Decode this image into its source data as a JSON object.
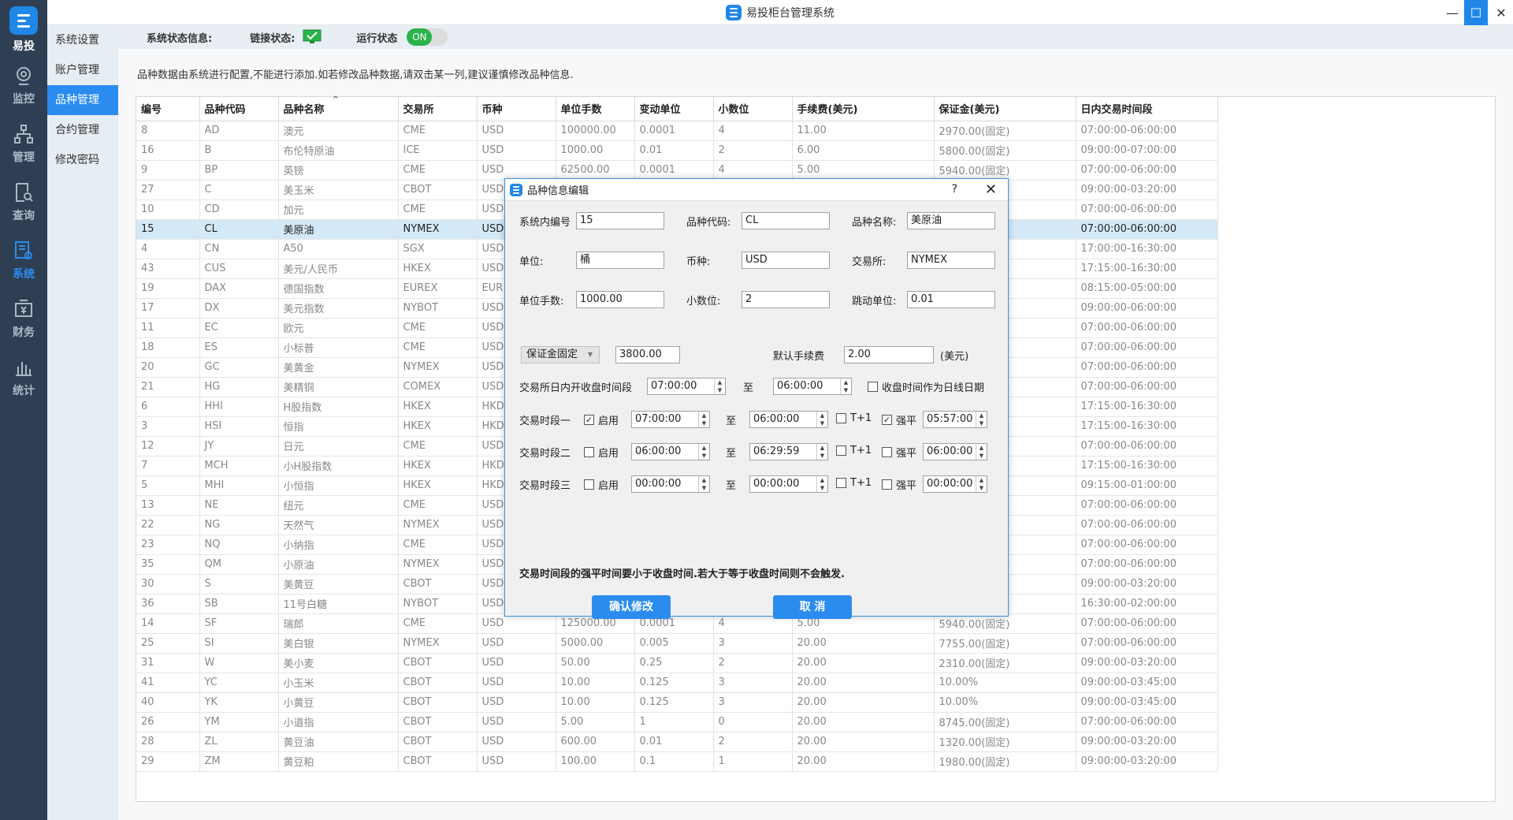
{
  "app": {
    "title": "易投柜台管理系统",
    "logo_label": "易投",
    "accent_color": "#1f87e8",
    "sidebar_bg": "#2f3f53"
  },
  "nav": [
    {
      "label": "监控",
      "icon": "monitor-camera-icon"
    },
    {
      "label": "管理",
      "icon": "org-chart-icon"
    },
    {
      "label": "查询",
      "icon": "search-document-icon"
    },
    {
      "label": "系统",
      "icon": "system-settings-icon",
      "active": true
    },
    {
      "label": "财务",
      "icon": "finance-icon"
    },
    {
      "label": "统计",
      "icon": "bar-chart-icon"
    }
  ],
  "subnav": [
    {
      "label": "系统设置"
    },
    {
      "label": "账户管理"
    },
    {
      "label": "品种管理",
      "active": true
    },
    {
      "label": "合约管理"
    },
    {
      "label": "修改密码"
    }
  ],
  "status": {
    "title": "系统状态信息:",
    "link_label": "链接状态:",
    "run_label": "运行状态",
    "run_value": "ON"
  },
  "notice": "品种数据由系统进行配置,不能进行添加.如若修改品种数据,请双击某一列,建议谨慎修改品种信息.",
  "table": {
    "headers": [
      "编号",
      "品种代码",
      "品种名称",
      "交易所",
      "币种",
      "单位手数",
      "变动单位",
      "小数位",
      "手续费(美元)",
      "保证金(美元)",
      "日内交易时间段"
    ],
    "rows": [
      [
        "8",
        "AD",
        "澳元",
        "CME",
        "USD",
        "100000.00",
        "0.0001",
        "4",
        "11.00",
        "2970.00(固定)",
        "07:00:00-06:00:00"
      ],
      [
        "16",
        "B",
        "布伦特原油",
        "ICE",
        "USD",
        "1000.00",
        "0.01",
        "2",
        "6.00",
        "5800.00(固定)",
        "09:00:00-07:00:00"
      ],
      [
        "9",
        "BP",
        "英镑",
        "CME",
        "USD",
        "62500.00",
        "0.0001",
        "4",
        "5.00",
        "5940.00(固定)",
        "07:00:00-06:00:00"
      ],
      [
        "27",
        "C",
        "美玉米",
        "CBOT",
        "USD",
        "",
        "",
        "",
        "",
        "",
        "09:00:00-03:20:00"
      ],
      [
        "10",
        "CD",
        "加元",
        "CME",
        "USD",
        "",
        "",
        "",
        "",
        "",
        "07:00:00-06:00:00"
      ],
      [
        "15",
        "CL",
        "美原油",
        "NYMEX",
        "USD",
        "",
        "",
        "",
        "",
        "",
        "07:00:00-06:00:00"
      ],
      [
        "4",
        "CN",
        "A50",
        "SGX",
        "USD",
        "",
        "",
        "",
        "",
        "",
        "17:00:00-16:30:00"
      ],
      [
        "43",
        "CUS",
        "美元/人民币",
        "HKEX",
        "USD",
        "",
        "",
        "",
        "",
        "",
        "17:15:00-16:30:00"
      ],
      [
        "19",
        "DAX",
        "德国指数",
        "EUREX",
        "EUR",
        "",
        "",
        "",
        "",
        "",
        "08:15:00-05:00:00"
      ],
      [
        "17",
        "DX",
        "美元指数",
        "NYBOT",
        "USD",
        "",
        "",
        "",
        "",
        "",
        "09:00:00-06:00:00"
      ],
      [
        "11",
        "EC",
        "欧元",
        "CME",
        "USD",
        "",
        "",
        "",
        "",
        "",
        "07:00:00-06:00:00"
      ],
      [
        "18",
        "ES",
        "小标普",
        "CME",
        "USD",
        "",
        "",
        "",
        "",
        "",
        "07:00:00-06:00:00"
      ],
      [
        "20",
        "GC",
        "美黄金",
        "NYMEX",
        "USD",
        "",
        "",
        "",
        "",
        "",
        "07:00:00-06:00:00"
      ],
      [
        "21",
        "HG",
        "美精铜",
        "COMEX",
        "USD",
        "",
        "",
        "",
        "",
        "",
        "07:00:00-06:00:00"
      ],
      [
        "6",
        "HHI",
        "H股指数",
        "HKEX",
        "HKD",
        "",
        "",
        "",
        "",
        "",
        "17:15:00-16:30:00"
      ],
      [
        "3",
        "HSI",
        "恒指",
        "HKEX",
        "HKD",
        "",
        "",
        "",
        "",
        "",
        "17:15:00-16:30:00"
      ],
      [
        "12",
        "JY",
        "日元",
        "CME",
        "USD",
        "",
        "",
        "",
        "",
        "",
        "07:00:00-06:00:00"
      ],
      [
        "7",
        "MCH",
        "小H股指数",
        "HKEX",
        "HKD",
        "",
        "",
        "",
        "",
        "",
        "17:15:00-16:30:00"
      ],
      [
        "5",
        "MHI",
        "小恒指",
        "HKEX",
        "HKD",
        "",
        "",
        "",
        "",
        "",
        "09:15:00-01:00:00"
      ],
      [
        "13",
        "NE",
        "纽元",
        "CME",
        "USD",
        "",
        "",
        "",
        "",
        "",
        "07:00:00-06:00:00"
      ],
      [
        "22",
        "NG",
        "天然气",
        "NYMEX",
        "USD",
        "",
        "",
        "",
        "",
        "",
        "07:00:00-06:00:00"
      ],
      [
        "23",
        "NQ",
        "小纳指",
        "CME",
        "USD",
        "",
        "",
        "",
        "",
        "",
        "07:00:00-06:00:00"
      ],
      [
        "35",
        "QM",
        "小原油",
        "NYMEX",
        "USD",
        "",
        "",
        "",
        "",
        "",
        "07:00:00-06:00:00"
      ],
      [
        "30",
        "S",
        "美黄豆",
        "CBOT",
        "USD",
        "",
        "",
        "",
        "",
        "",
        "09:00:00-03:20:00"
      ],
      [
        "36",
        "SB",
        "11号白糖",
        "NYBOT",
        "USD",
        "",
        "",
        "",
        "",
        "",
        "16:30:00-02:00:00"
      ],
      [
        "14",
        "SF",
        "瑞郎",
        "CME",
        "USD",
        "125000.00",
        "0.0001",
        "4",
        "5.00",
        "5940.00(固定)",
        "07:00:00-06:00:00"
      ],
      [
        "25",
        "SI",
        "美白银",
        "NYMEX",
        "USD",
        "5000.00",
        "0.005",
        "3",
        "20.00",
        "7755.00(固定)",
        "07:00:00-06:00:00"
      ],
      [
        "31",
        "W",
        "美小麦",
        "CBOT",
        "USD",
        "50.00",
        "0.25",
        "2",
        "20.00",
        "2310.00(固定)",
        "09:00:00-03:20:00"
      ],
      [
        "41",
        "YC",
        "小玉米",
        "CBOT",
        "USD",
        "10.00",
        "0.125",
        "3",
        "20.00",
        "10.00%",
        "09:00:00-03:45:00"
      ],
      [
        "40",
        "YK",
        "小黄豆",
        "CBOT",
        "USD",
        "10.00",
        "0.125",
        "3",
        "20.00",
        "10.00%",
        "09:00:00-03:45:00"
      ],
      [
        "26",
        "YM",
        "小道指",
        "CBOT",
        "USD",
        "5.00",
        "1",
        "0",
        "20.00",
        "8745.00(固定)",
        "07:00:00-06:00:00"
      ],
      [
        "28",
        "ZL",
        "黄豆油",
        "CBOT",
        "USD",
        "600.00",
        "0.01",
        "2",
        "20.00",
        "1320.00(固定)",
        "09:00:00-03:20:00"
      ],
      [
        "29",
        "ZM",
        "黄豆粕",
        "CBOT",
        "USD",
        "100.00",
        "0.1",
        "1",
        "20.00",
        "1980.00(固定)",
        "09:00:00-03:20:00"
      ]
    ],
    "selected_index": 5
  },
  "dialog": {
    "title": "品种信息编辑",
    "help": "?",
    "close": "✕",
    "fields": {
      "sys_id_label": "系统内编号",
      "sys_id": "15",
      "code_label": "品种代码:",
      "code": "CL",
      "name_label": "品种名称:",
      "name": "美原油",
      "unit_label": "单位:",
      "unit": "桶",
      "currency_label": "币种:",
      "currency": "USD",
      "exchange_label": "交易所:",
      "exchange": "NYMEX",
      "lot_label": "单位手数:",
      "lot": "1000.00",
      "decimals_label": "小数位:",
      "decimals": "2",
      "tick_label": "跳动单位:",
      "tick": "0.01"
    },
    "margin_mode": "保证金固定",
    "margin_value": "3800.00",
    "fee_label": "默认手续费",
    "fee_value": "2.00",
    "fee_unit": "(美元)",
    "session_label": "交易所日内开收盘时间段",
    "session_start": "07:00:00",
    "to": "至",
    "session_end": "06:00:00",
    "close_as_date_label": "收盘时间作为日线日期",
    "periods": [
      {
        "label": "交易时段一",
        "enabled": true,
        "start": "07:00:00",
        "end": "06:00:00",
        "t1": false,
        "force": true,
        "force_time": "05:57:00"
      },
      {
        "label": "交易时段二",
        "enabled": false,
        "start": "06:00:00",
        "end": "06:29:59",
        "t1": false,
        "force": false,
        "force_time": "06:00:00"
      },
      {
        "label": "交易时段三",
        "enabled": false,
        "start": "00:00:00",
        "end": "00:00:00",
        "t1": false,
        "force": false,
        "force_time": "00:00:00"
      }
    ],
    "enable_label": "启用",
    "t1_label": "T+1",
    "force_label": "强平",
    "warning": "交易时间段的强平时间要小于收盘时间.若大于等于收盘时间则不会触发.",
    "confirm": "确认修改",
    "cancel": "取 消"
  }
}
